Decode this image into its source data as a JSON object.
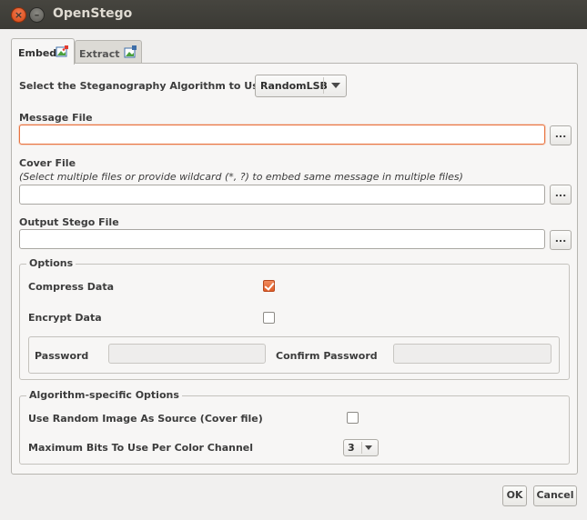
{
  "window": {
    "title": "OpenStego"
  },
  "tabs": [
    {
      "label": "Embed",
      "active": true,
      "icon": "embed-picture-icon"
    },
    {
      "label": "Extract",
      "active": false,
      "icon": "extract-picture-icon"
    }
  ],
  "algorithm": {
    "label": "Select the Steganography Algorithm to Use",
    "value": "RandomLSB"
  },
  "message_file": {
    "label": "Message File",
    "value": "",
    "browse_label": "..."
  },
  "cover_file": {
    "label": "Cover File",
    "hint": "(Select multiple files or provide wildcard (*, ?) to embed same message in multiple files)",
    "value": "",
    "browse_label": "..."
  },
  "output_file": {
    "label": "Output Stego File",
    "value": "",
    "browse_label": "..."
  },
  "options": {
    "legend": "Options",
    "compress": {
      "label": "Compress Data",
      "checked": true
    },
    "encrypt": {
      "label": "Encrypt Data",
      "checked": false
    },
    "password": {
      "label": "Password",
      "value": ""
    },
    "confirm_password": {
      "label": "Confirm Password",
      "value": ""
    }
  },
  "algo_options": {
    "legend": "Algorithm-specific Options",
    "random_image": {
      "label": "Use Random Image As Source (Cover file)",
      "checked": false
    },
    "max_bits": {
      "label": "Maximum Bits To Use Per Color Channel",
      "value": "3"
    }
  },
  "buttons": {
    "ok": "OK",
    "cancel": "Cancel"
  },
  "colors": {
    "accent": "#e9733f",
    "titlebar": "#3c3b37",
    "background": "#f1f0ef"
  }
}
